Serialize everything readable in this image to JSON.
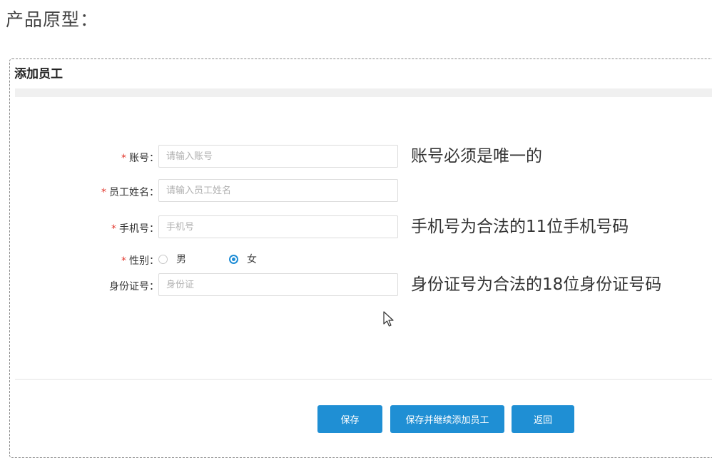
{
  "heading": "产品原型：",
  "panel_title": "添加员工",
  "form": {
    "account": {
      "required": "*",
      "label": "账号：",
      "placeholder": "请输入账号",
      "note": "账号必须是唯一的"
    },
    "name": {
      "required": "*",
      "label": "员工姓名：",
      "placeholder": "请输入员工姓名"
    },
    "phone": {
      "required": "*",
      "label": "手机号：",
      "placeholder": "手机号",
      "note": "手机号为合法的11位手机号码"
    },
    "gender": {
      "required": "*",
      "label": "性别：",
      "options": [
        "男",
        "女"
      ],
      "selected": "女"
    },
    "id_card": {
      "label": "身份证号：",
      "placeholder": "身份证",
      "note": "身份证号为合法的18位身份证号码"
    }
  },
  "buttons": {
    "save": "保存",
    "save_continue": "保存并继续添加员工",
    "back": "返回"
  },
  "colors": {
    "primary": "#1f8fd4",
    "required": "#e2382e"
  },
  "icons": {
    "cursor": "mouse-pointer-icon"
  }
}
